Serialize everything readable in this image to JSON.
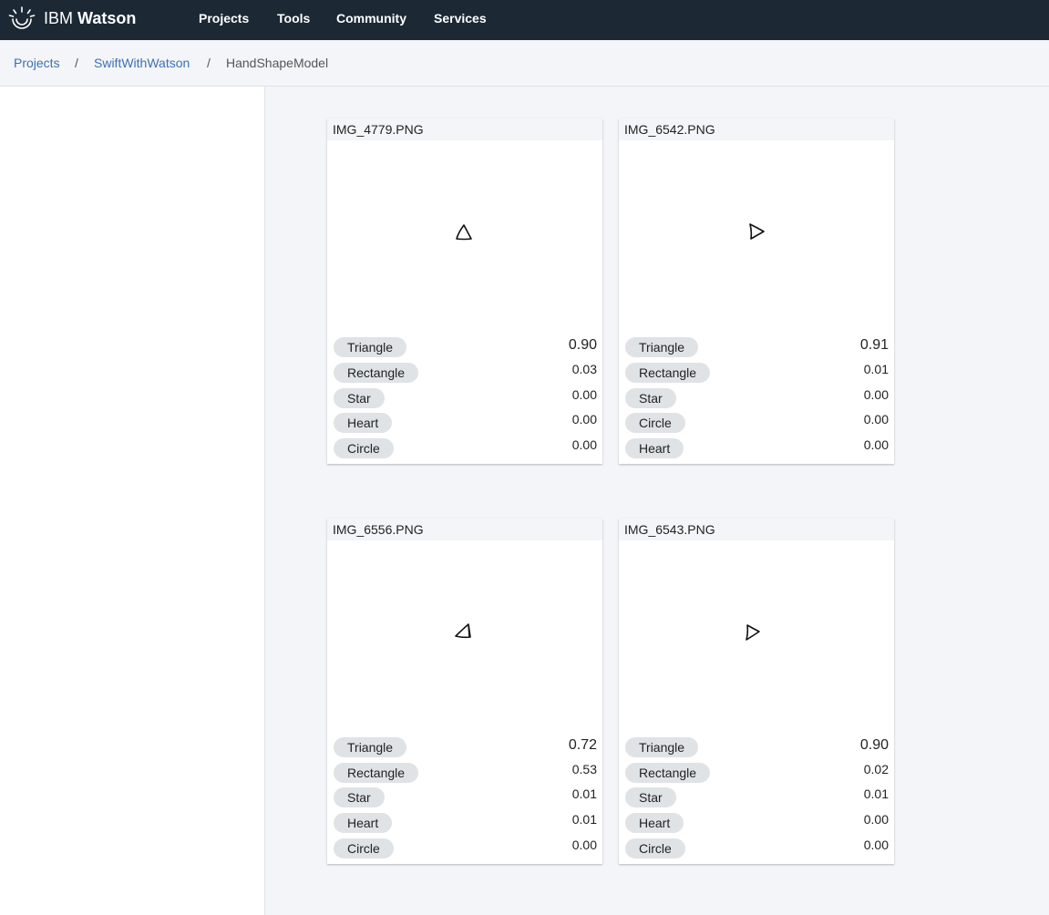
{
  "header": {
    "brand_prefix": "IBM",
    "brand_name": "Watson",
    "nav": [
      "Projects",
      "Tools",
      "Community",
      "Services"
    ]
  },
  "breadcrumb": {
    "items": [
      "Projects",
      "SwiftWithWatson",
      "HandShapeModel"
    ],
    "separator": "/"
  },
  "cards": [
    {
      "filename": "IMG_4779.PNG",
      "results": [
        {
          "label": "Triangle",
          "score": "0.90"
        },
        {
          "label": "Rectangle",
          "score": "0.03"
        },
        {
          "label": "Star",
          "score": "0.00"
        },
        {
          "label": "Heart",
          "score": "0.00"
        },
        {
          "label": "Circle",
          "score": "0.00"
        }
      ]
    },
    {
      "filename": "IMG_6542.PNG",
      "results": [
        {
          "label": "Triangle",
          "score": "0.91"
        },
        {
          "label": "Rectangle",
          "score": "0.01"
        },
        {
          "label": "Star",
          "score": "0.00"
        },
        {
          "label": "Circle",
          "score": "0.00"
        },
        {
          "label": "Heart",
          "score": "0.00"
        }
      ]
    },
    {
      "filename": "IMG_6556.PNG",
      "results": [
        {
          "label": "Triangle",
          "score": "0.72"
        },
        {
          "label": "Rectangle",
          "score": "0.53"
        },
        {
          "label": "Star",
          "score": "0.01"
        },
        {
          "label": "Heart",
          "score": "0.01"
        },
        {
          "label": "Circle",
          "score": "0.00"
        }
      ]
    },
    {
      "filename": "IMG_6543.PNG",
      "results": [
        {
          "label": "Triangle",
          "score": "0.90"
        },
        {
          "label": "Rectangle",
          "score": "0.02"
        },
        {
          "label": "Star",
          "score": "0.01"
        },
        {
          "label": "Heart",
          "score": "0.00"
        },
        {
          "label": "Circle",
          "score": "0.00"
        }
      ]
    }
  ],
  "colors": {
    "topbar": "#1c2834",
    "link": "#3d70b2",
    "tag_background": "#dfe3e6",
    "page_background": "#f4f5f8"
  }
}
